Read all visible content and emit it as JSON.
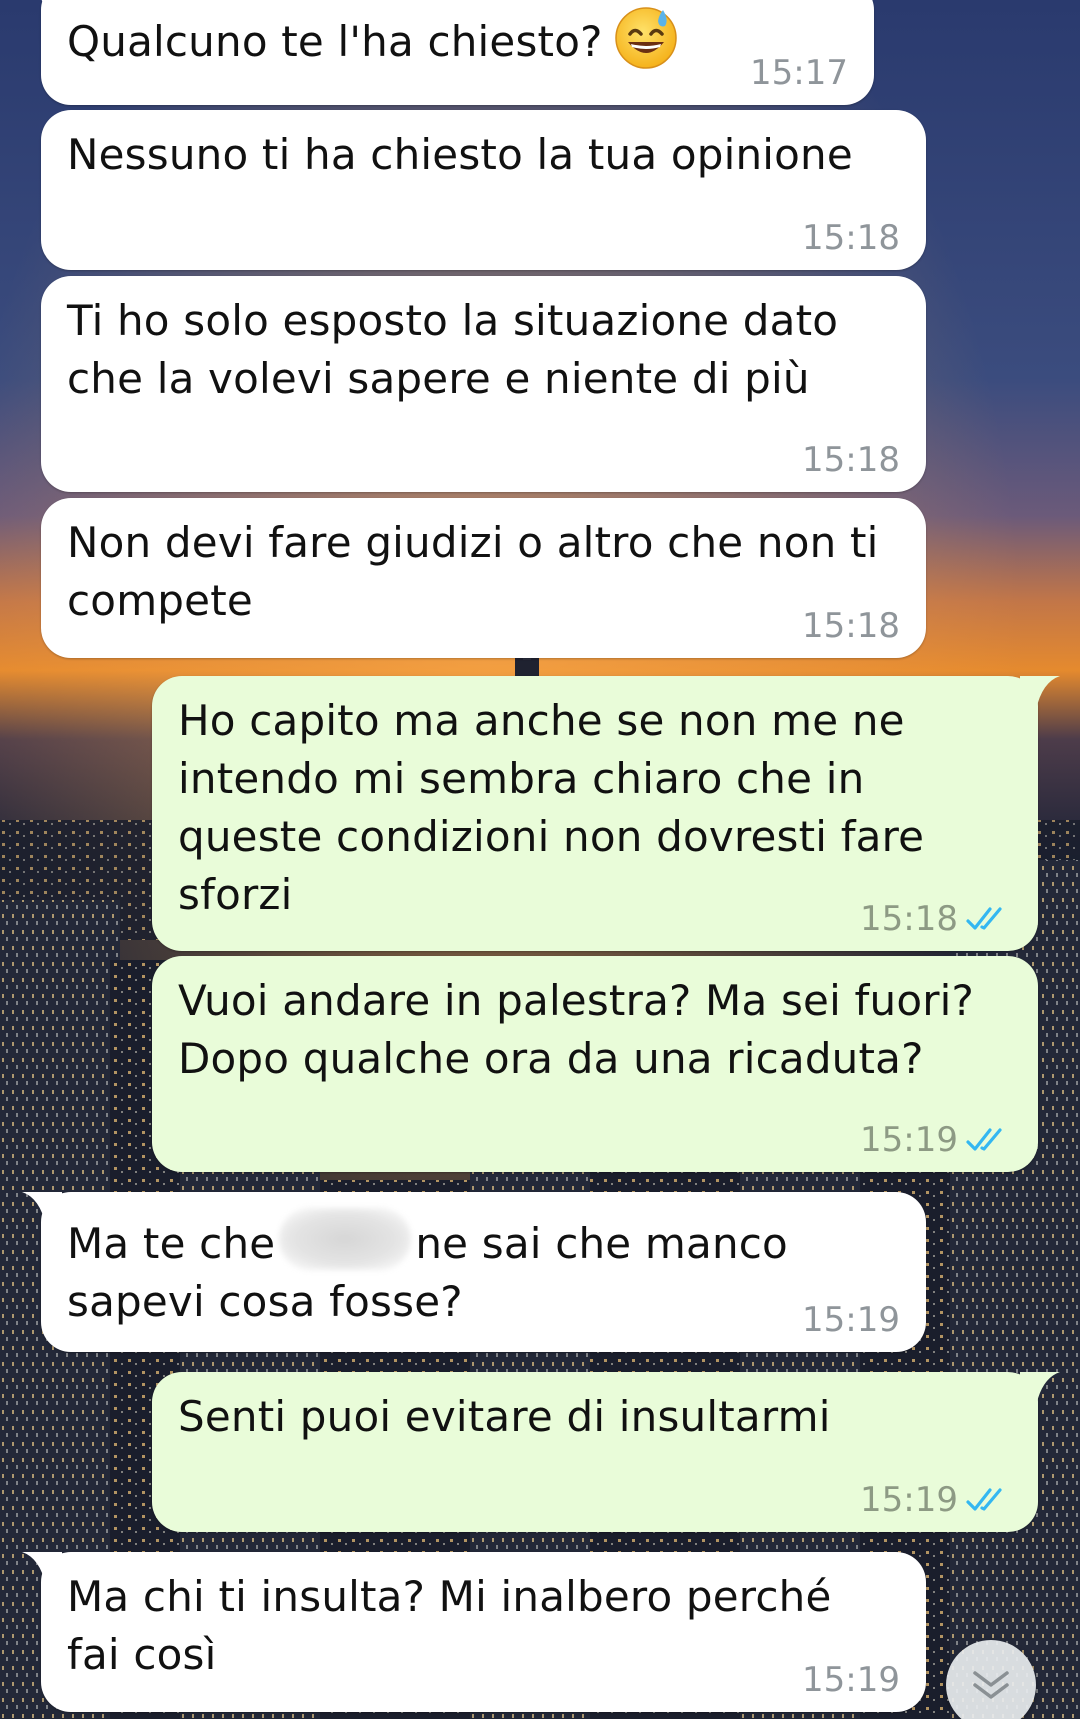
{
  "conversation": {
    "messages": [
      {
        "direction": "incoming",
        "text": "Qualcuno te l'ha chiesto?",
        "emoji": "sweat-smile-emoji",
        "time": "15:17"
      },
      {
        "direction": "incoming",
        "text": "Nessuno ti ha chiesto la tua opinione",
        "time": "15:18"
      },
      {
        "direction": "incoming",
        "text": "Ti ho solo esposto la situazione dato\nche la volevi sapere e niente di più",
        "time": "15:18"
      },
      {
        "direction": "incoming",
        "text": "Non devi fare giudizi o altro che non ti\ncompete",
        "time": "15:18"
      },
      {
        "direction": "outgoing",
        "text": "Ho capito ma anche se non me ne\nintendo mi sembra chiaro che in\nqueste condizioni non dovresti fare\nsforzi",
        "time": "15:18",
        "status": "read"
      },
      {
        "direction": "outgoing",
        "text": "Vuoi andare in palestra? Ma sei fuori?\nDopo qualche ora da una ricaduta?",
        "time": "15:19",
        "status": "read"
      },
      {
        "direction": "incoming",
        "text_before": "Ma te che",
        "text_after": "ne sai che manco\nsapevi cosa fosse?",
        "redacted": true,
        "time": "15:19"
      },
      {
        "direction": "outgoing",
        "text": "Senti puoi evitare di insultarmi",
        "time": "15:19",
        "status": "read"
      },
      {
        "direction": "incoming",
        "text": "Ma chi ti insulta? Mi inalbero perché\nfai così",
        "time": "15:19"
      }
    ]
  },
  "colors": {
    "incoming_bubble": "#ffffff",
    "outgoing_bubble": "#e9fcd9",
    "read_ticks": "#34b7f1",
    "timestamp": "#8f959a"
  },
  "icons": {
    "read_status": "double-check-icon",
    "scroll_down": "double-chevron-down-icon",
    "emoji": "sweat-smile-emoji"
  }
}
